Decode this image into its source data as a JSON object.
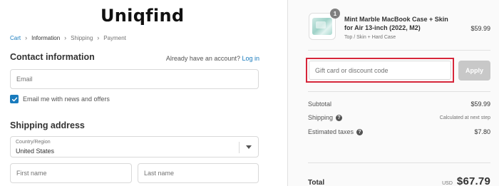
{
  "brand": {
    "logo_text": "Uniqfind"
  },
  "breadcrumb": {
    "items": [
      {
        "label": "Cart",
        "state": "link"
      },
      {
        "label": "Information",
        "state": "active"
      },
      {
        "label": "Shipping",
        "state": "inactive"
      },
      {
        "label": "Payment",
        "state": "inactive"
      }
    ]
  },
  "contact": {
    "title": "Contact information",
    "have_account_text": "Already have an account?",
    "login_label": "Log in",
    "email_placeholder": "Email",
    "newsletter_label": "Email me with news and offers",
    "newsletter_checked": true
  },
  "shipping": {
    "title": "Shipping address",
    "country_label": "Country/Region",
    "country_value": "United States",
    "first_name_placeholder": "First name",
    "last_name_placeholder": "Last name"
  },
  "order_summary": {
    "product": {
      "quantity": "1",
      "name": "Mint Marble MacBook Case + Skin for Air 13-inch (2022, M2)",
      "variant": "Top / Skin + Hard Case",
      "price": "$59.99"
    },
    "discount": {
      "placeholder": "Gift card or discount code",
      "apply_label": "Apply"
    },
    "subtotal_label": "Subtotal",
    "subtotal_value": "$59.99",
    "shipping_label": "Shipping",
    "shipping_value": "Calculated at next step",
    "taxes_label": "Estimated taxes",
    "taxes_value": "$7.80",
    "total_label": "Total",
    "currency": "USD",
    "total_value": "$67.79"
  },
  "colors": {
    "accent": "#197bbd",
    "highlight_border": "#d6263a",
    "apply_disabled": "#c8c8c8",
    "summary_bg": "#fafafa"
  },
  "icons": {
    "checkbox": "checkmark-icon",
    "breadcrumb_separator": "chevron-right-icon",
    "select": "chevron-down-icon",
    "help": "question-circle-icon"
  }
}
